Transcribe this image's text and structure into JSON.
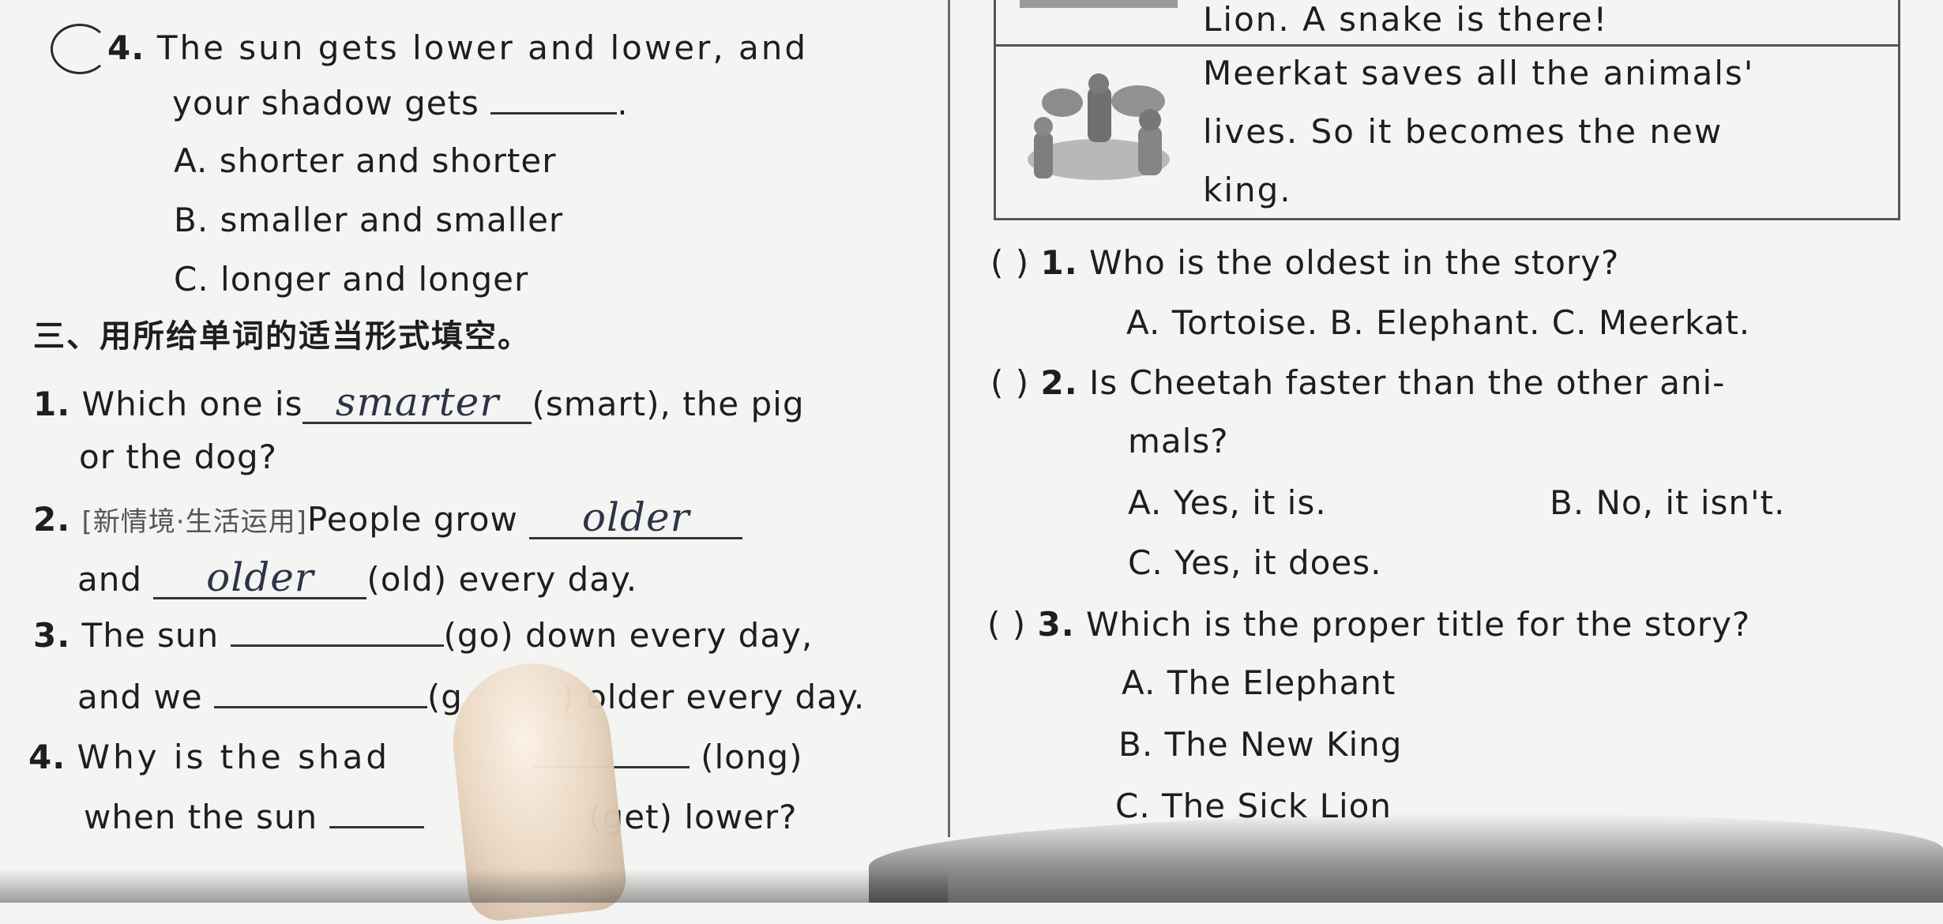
{
  "left": {
    "q4_head": {
      "num": "4.",
      "text": "The sun gets lower and lower, and"
    },
    "q4_line2": {
      "text": "your shadow gets",
      "end": "."
    },
    "q4_options": [
      "A. shorter and shorter",
      "B. smaller and smaller",
      "C. longer and longer"
    ],
    "section3_title": "三、用所给单词的适当形式填空。",
    "f1": {
      "num": "1.",
      "pre": "Which one is",
      "answer": "smarter",
      "post": "(smart), the pig",
      "line2": "or the dog?"
    },
    "f2": {
      "num": "2.",
      "tag": "[新情境·生活运用]",
      "pre": "People grow",
      "answer1": "older",
      "line2_pre": "and",
      "answer2": "older",
      "line2_post": "(old) every day."
    },
    "f3": {
      "num": "3.",
      "pre": "The sun",
      "post": "(go) down every day,",
      "line2_pre": "and we",
      "line2_hint": "(g",
      "line2_post": ") older every day."
    },
    "f4": {
      "num": "4.",
      "pre": "Why  is  the  shad",
      "post": "(long)",
      "line2_pre": "when the sun",
      "line2_post": "(get) lower?"
    }
  },
  "right": {
    "story_row1": "Lion. A snake is there!",
    "story_row2": [
      "Meerkat saves all the animals'",
      "lives.  So  it  becomes  the  new",
      "king."
    ],
    "q1": {
      "paren": "(      )",
      "num": "1.",
      "text": "Who is the oldest in the story?",
      "options": "A. Tortoise.  B. Elephant.  C. Meerkat."
    },
    "q2": {
      "paren": "(      )",
      "num": "2.",
      "text": "Is Cheetah faster than the other ani-",
      "line2": "mals?",
      "optA": "A. Yes, it is.",
      "optB": "B. No, it isn't.",
      "optC": "C. Yes, it does."
    },
    "q3": {
      "paren": "(      )",
      "num": "3.",
      "text": "Which is the proper title for the story?",
      "options": [
        "A. The Elephant",
        "B. The New King",
        "C. The Sick Lion"
      ]
    }
  },
  "colors": {
    "ink": "#1e1e1e",
    "paper": "#f4f4f2",
    "handwriting": "#2d3447"
  }
}
